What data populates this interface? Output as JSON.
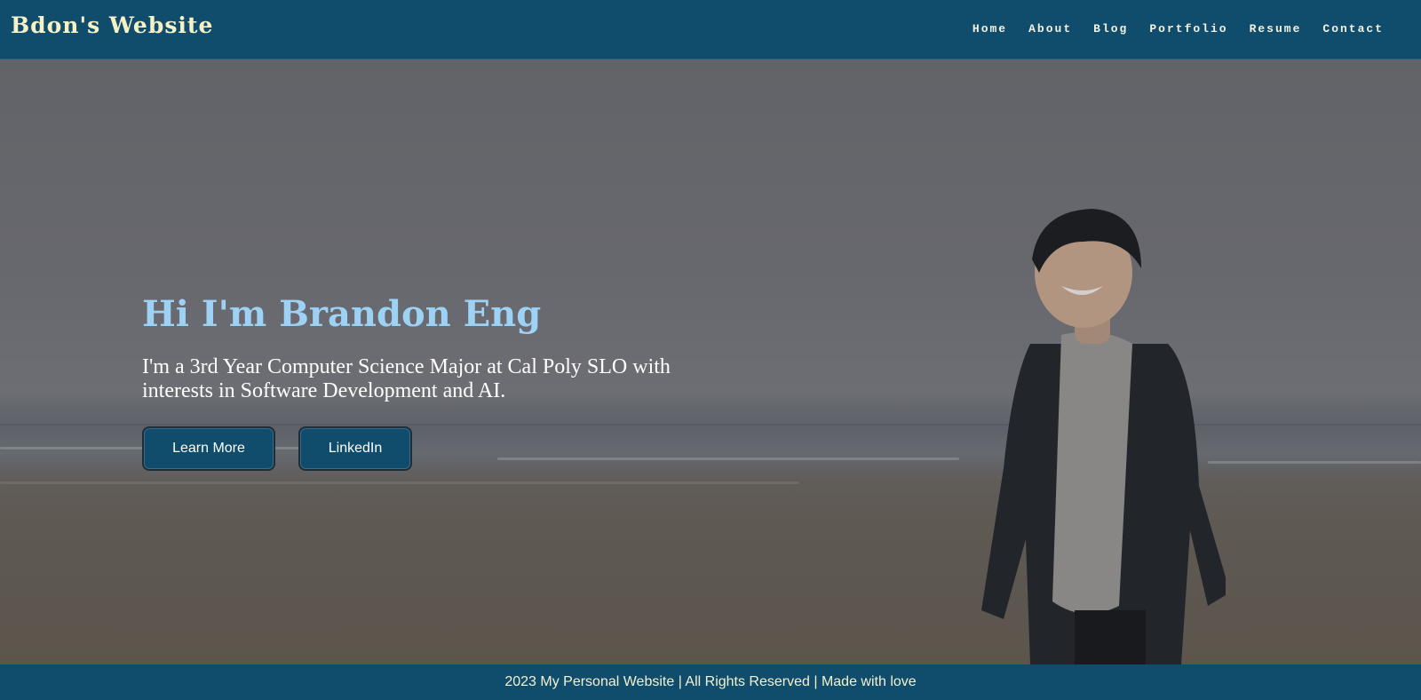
{
  "header": {
    "brand": "Bdon's Website",
    "nav": [
      {
        "label": "Home"
      },
      {
        "label": "About"
      },
      {
        "label": "Blog"
      },
      {
        "label": "Portfolio"
      },
      {
        "label": "Resume"
      },
      {
        "label": "Contact"
      }
    ]
  },
  "hero": {
    "title": "Hi I'm Brandon Eng",
    "subtitle": "I'm a 3rd Year Computer Science Major at Cal Poly SLO with interests in Software Development and AI.",
    "buttons": {
      "learn_more": "Learn More",
      "linkedin": "LinkedIn"
    }
  },
  "footer": {
    "text": "2023 My Personal Website | All Rights Reserved | Made with love"
  },
  "colors": {
    "header_bg": "#104c6c",
    "brand_text": "#f6f2c8",
    "hero_title": "#9dd2f5",
    "button_bg": "#104c6c"
  }
}
